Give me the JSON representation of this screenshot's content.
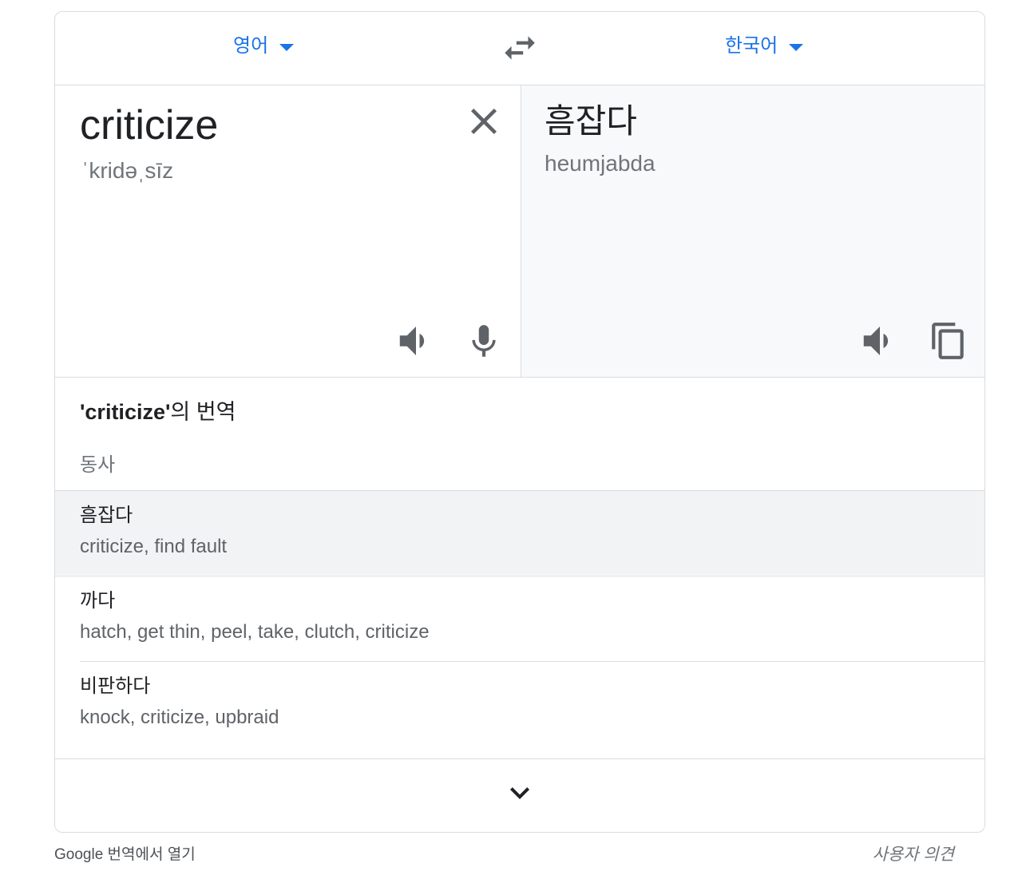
{
  "header": {
    "source_language": "영어",
    "target_language": "한국어"
  },
  "source": {
    "text": "criticize",
    "phonetic": "ˈkridəˌsīz"
  },
  "target": {
    "text": "흠잡다",
    "romanization": "heumjabda"
  },
  "dictionary": {
    "title_word": "'criticize'",
    "title_suffix": "의 번역",
    "part_of_speech": "동사",
    "entries": [
      {
        "word": "흠잡다",
        "synonyms": "criticize, find fault"
      },
      {
        "word": "까다",
        "synonyms": "hatch, get thin, peel, take, clutch, criticize"
      },
      {
        "word": "비판하다",
        "synonyms": "knock, criticize, upbraid"
      }
    ]
  },
  "footer": {
    "open_in_translate": "Google 번역에서 열기",
    "feedback": "사용자 의견"
  },
  "icons": {
    "language_dropdown": "arrow-drop-down-icon",
    "swap": "swap-horiz-icon",
    "clear": "close-icon",
    "listen": "volume-icon",
    "voice_input": "mic-icon",
    "copy": "copy-icon",
    "expand": "chevron-down-icon"
  },
  "colors": {
    "accent": "#1a73e8",
    "icon": "#5f6368",
    "text": "#202124",
    "secondary_text": "#70757a",
    "border": "#dadce0",
    "target_pane_bg": "#f8f9fa",
    "row_highlight_bg": "#f1f3f4",
    "footer_text": "#4d5156"
  }
}
